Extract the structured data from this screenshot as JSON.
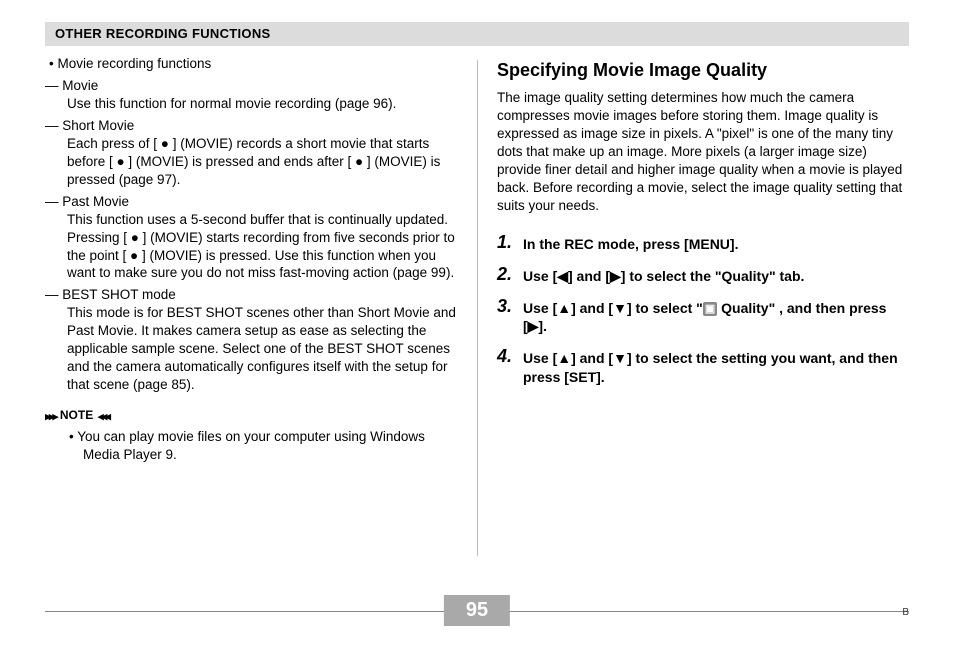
{
  "header": {
    "title": "OTHER RECORDING FUNCTIONS"
  },
  "left": {
    "intro": "Movie recording functions",
    "items": [
      {
        "title": "Movie",
        "body": "Use this function for normal movie recording (page 96)."
      },
      {
        "title": "Short Movie",
        "body": "Each press of [ ● ] (MOVIE) records a short movie that starts before [ ● ] (MOVIE) is pressed and ends after [ ● ] (MOVIE) is pressed (page 97)."
      },
      {
        "title": "Past Movie",
        "body": "This function uses a 5-second buffer that is continually updated. Pressing [ ● ] (MOVIE) starts recording from five seconds prior to the point [ ● ] (MOVIE) is pressed. Use this function when you want to make sure you do not miss fast-moving action (page 99)."
      },
      {
        "title": "BEST SHOT mode",
        "body": "This mode is for BEST SHOT scenes other than Short Movie and Past Movie. It makes camera setup as ease as selecting the applicable sample scene. Select one of the BEST SHOT scenes and the camera automatically configures itself with the setup for that scene (page 85)."
      }
    ],
    "note": {
      "label": "NOTE",
      "body": "You can play movie files on your computer using Windows Media Player 9."
    }
  },
  "right": {
    "heading": "Specifying Movie Image Quality",
    "intro": "The image quality setting determines how much the camera compresses movie images before storing them. Image quality is expressed as image size in pixels. A \"pixel\" is one of the many tiny dots that make up an image. More pixels (a larger image size) provide finer detail and higher image quality when a movie is played back. Before recording a movie, select the image quality setting that suits your needs.",
    "steps": [
      {
        "n": "1",
        "text_plain": "In the REC mode, press [MENU]."
      },
      {
        "n": "2",
        "text_plain": "Use [◀] and [▶] to select the \"Quality\" tab."
      },
      {
        "n": "3",
        "text_prefix": "Use [▲] and [▼] to select \"",
        "text_mid": " Quality\" , and then press [▶]."
      },
      {
        "n": "4",
        "text_plain": "Use [▲] and [▼] to select the setting you want, and then press [SET]."
      }
    ]
  },
  "footer": {
    "page": "95",
    "corner": "B"
  }
}
